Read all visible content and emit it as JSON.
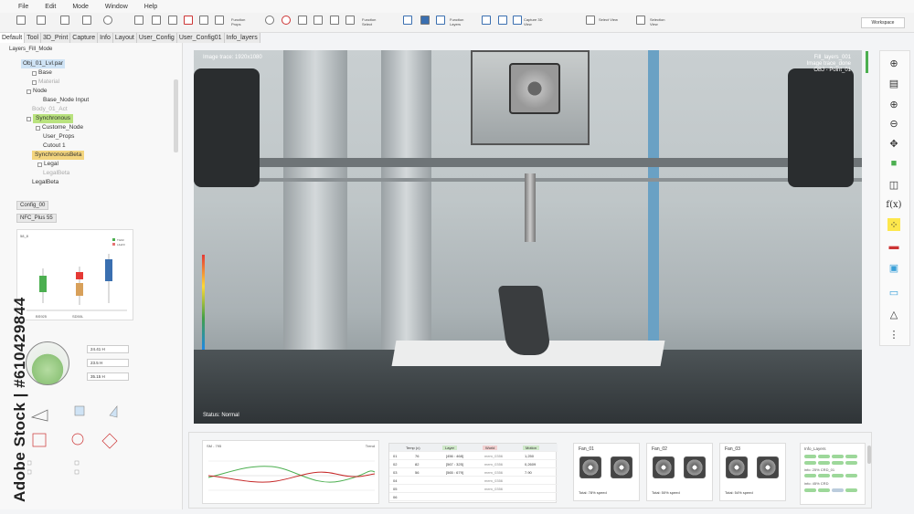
{
  "menu": [
    "File",
    "Edit",
    "Mode",
    "Window",
    "Help"
  ],
  "toolbar": {
    "function_props": "Function Props",
    "function_select": "Function Select",
    "function_layers": "Function Layers",
    "capture_3d": "Capture 3D View",
    "select_view": "Select View",
    "selection_view": "Selection View",
    "workspace": "Workspace"
  },
  "tabs": [
    "Default",
    "Tool",
    "3D_Print",
    "Capture",
    "Info",
    "Layout",
    "User_Config",
    "User_Config01",
    "Info_layers"
  ],
  "left": {
    "title": "Layers_Fill_Mode",
    "tree": [
      {
        "label": "Obj_01_Lvl.par",
        "style": "hl-blue"
      },
      {
        "label": "Base",
        "style": ""
      },
      {
        "label": "Material",
        "style": "faded"
      },
      {
        "label": "Node",
        "style": ""
      },
      {
        "label": "Base_Node Input",
        "style": ""
      },
      {
        "label": "Body_01_Act",
        "style": "faded"
      },
      {
        "label": "Synchronous",
        "style": "hl-green"
      },
      {
        "label": "Custome_Node",
        "style": ""
      },
      {
        "label": "User_Props",
        "style": ""
      },
      {
        "label": "Cutout 1",
        "style": ""
      },
      {
        "label": "SynchronousBeta",
        "style": "hl-yellow"
      },
      {
        "label": "Legal",
        "style": ""
      },
      {
        "label": "LegalBeta",
        "style": "faded"
      },
      {
        "label": "LegalBeta",
        "style": ""
      }
    ],
    "config_btn": "Config_00",
    "nfc_btn": "NFC_Plus 55",
    "chart_title": "58_8",
    "legend": [
      "TG93",
      "L4aF0"
    ],
    "box_labels": [
      "BS925",
      "SD50L"
    ],
    "spins": [
      "24.41 H",
      "23.5 H",
      "35.15 H"
    ]
  },
  "viewport": {
    "top_left": "Image trace: 1920x1080",
    "top_right": [
      "Fill_layers_001",
      "Image trace_done",
      "OBJ - Point_01"
    ],
    "status": "Status: Normal"
  },
  "bottom": {
    "graph_title": "SM - 795",
    "graph_right": "Trend",
    "table_headers": [
      "",
      "Temp (c)",
      "Layer",
      "World",
      "Motion"
    ],
    "table_rows": [
      [
        "01",
        "76",
        "[456 : 468]",
        "mem_0356",
        "1,250"
      ],
      [
        "02",
        "82",
        "[567 : 325]",
        "mem_0356",
        "0,2609"
      ],
      [
        "03",
        "56",
        "[565 : 679]",
        "mem_0356",
        "7.90"
      ],
      [
        "04",
        "",
        "",
        "mem_0356",
        ""
      ],
      [
        "05",
        "",
        "",
        "mem_0356",
        ""
      ],
      [
        "06",
        "",
        "",
        "",
        ""
      ]
    ],
    "fans": [
      {
        "title": "Fan_01",
        "foot": "Total: 78% speed"
      },
      {
        "title": "Fan_02",
        "foot": "Total: 50% speed"
      },
      {
        "title": "Fan_03",
        "foot": "Total: 54% speed"
      }
    ],
    "info_title": "Info_Layers",
    "info_line1": "info: 25% CRD_01",
    "info_line2": "info: 45% CRD"
  },
  "watermark": "Adobe Stock | #610429844",
  "chart_data": {
    "type": "line",
    "title": "SM - 795",
    "series": [],
    "x": [],
    "xlabel": "",
    "ylabel": ""
  }
}
